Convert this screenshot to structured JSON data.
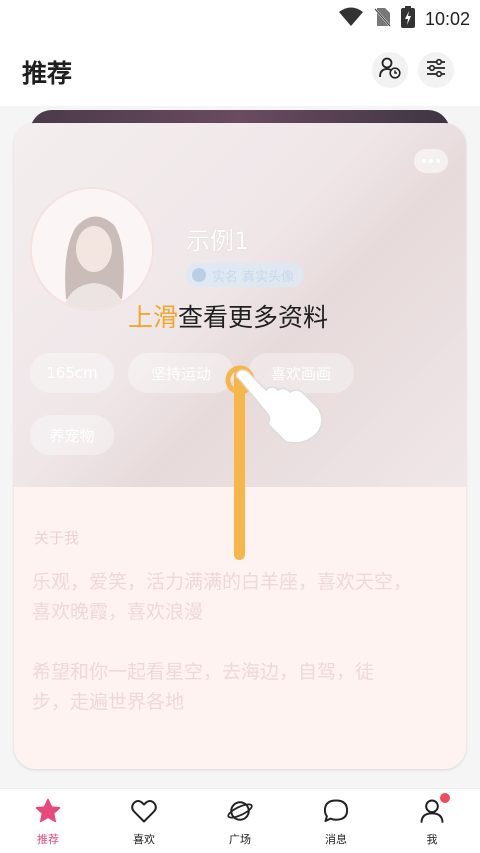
{
  "status_bar": {
    "time": "10:02"
  },
  "header": {
    "title": "推荐"
  },
  "profile": {
    "name": "示例1",
    "verify_label": "实名 真实头像",
    "tags": [
      "165cm",
      "坚持运动",
      "喜欢画画",
      "养宠物"
    ],
    "about_label": "关于我",
    "about_lines": [
      "乐观，爱笑，活力满满的白羊座，喜欢天空，",
      "喜欢晚霞，喜欢浪漫"
    ],
    "wish_lines": [
      " 希望和你一起看星空，去海边，自驾，徒",
      "步，走遍世界各地"
    ]
  },
  "guide": {
    "highlight": "上滑",
    "rest": "查看更多资料"
  },
  "tabbar": {
    "items": [
      {
        "label": "推荐",
        "active": true
      },
      {
        "label": "喜欢"
      },
      {
        "label": "广场"
      },
      {
        "label": "消息"
      },
      {
        "label": "我",
        "badge": true
      }
    ]
  },
  "colors": {
    "accent": "#e8497b",
    "guide_highlight": "#f4a629",
    "track": "#f6b64a"
  }
}
